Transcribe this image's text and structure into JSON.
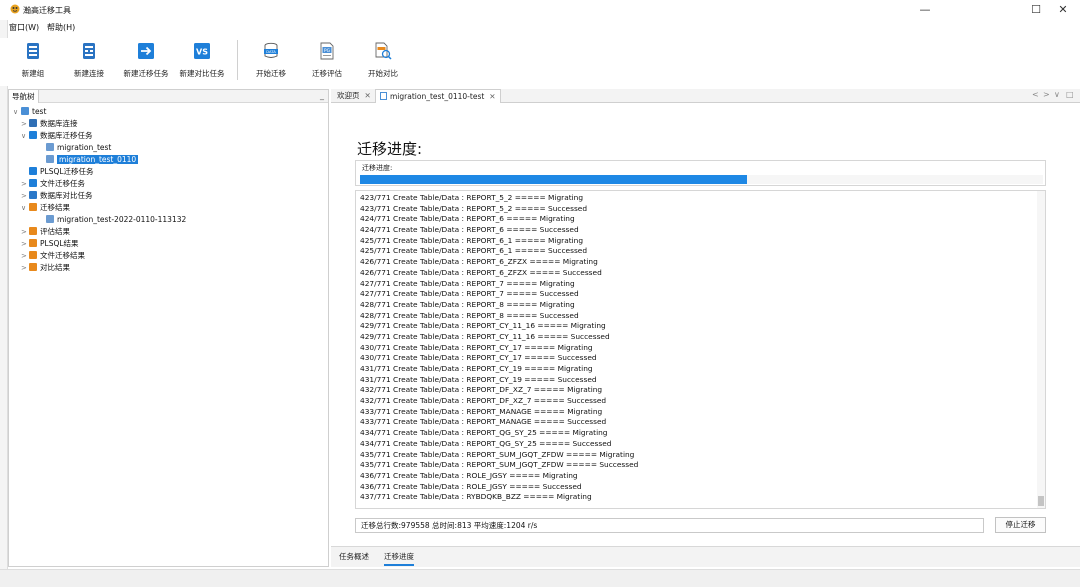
{
  "window": {
    "title": "瀚高迁移工具",
    "minimize": "—",
    "maximize": "☐",
    "close": "✕"
  },
  "menu": {
    "window": "窗口(W)",
    "help": "帮助(H)"
  },
  "toolbar": {
    "buttons": [
      {
        "label": "新建组",
        "icon": "database-group-icon"
      },
      {
        "label": "新建连接",
        "icon": "database-connection-icon"
      },
      {
        "label": "新建迁移任务",
        "icon": "migration-task-icon"
      },
      {
        "label": "新建对比任务",
        "icon": "compare-task-icon",
        "glyph": "VS"
      },
      {
        "label": "开始迁移",
        "icon": "start-migration-icon",
        "glyph": "DATA"
      },
      {
        "label": "迁移评估",
        "icon": "migration-assessment-icon",
        "glyph": "PG"
      },
      {
        "label": "开始对比",
        "icon": "start-compare-icon"
      }
    ]
  },
  "nav": {
    "tab_label": "导航树",
    "minimize": "_",
    "tree": [
      {
        "label": "test",
        "toggle": "∨",
        "level": 0,
        "color": "#4a8fd6"
      },
      {
        "label": "数据库连接",
        "toggle": ">",
        "level": 1,
        "color": "#2f6fb5"
      },
      {
        "label": "数据库迁移任务",
        "toggle": "∨",
        "level": 1,
        "color": "#1e7fd9"
      },
      {
        "label": "migration_test",
        "toggle": "",
        "level": 2,
        "color": "#6b9bd1"
      },
      {
        "label": "migration_test_0110",
        "toggle": "",
        "level": 2,
        "color": "#6b9bd1",
        "selected": true
      },
      {
        "label": "PLSQL迁移任务",
        "toggle": "",
        "level": 1,
        "color": "#1e7fd9"
      },
      {
        "label": "文件迁移任务",
        "toggle": ">",
        "level": 1,
        "color": "#1e7fd9"
      },
      {
        "label": "数据库对比任务",
        "toggle": ">",
        "level": 1,
        "color": "#2a78c9"
      },
      {
        "label": "迁移结果",
        "toggle": "∨",
        "level": 1,
        "color": "#e8891c"
      },
      {
        "label": "migration_test-2022-0110-113132",
        "toggle": "",
        "level": 2,
        "color": "#6b9bd1"
      },
      {
        "label": "评估结果",
        "toggle": ">",
        "level": 1,
        "color": "#e8891c"
      },
      {
        "label": "PLSQL结果",
        "toggle": ">",
        "level": 1,
        "color": "#e8891c"
      },
      {
        "label": "文件迁移结果",
        "toggle": ">",
        "level": 1,
        "color": "#e8891c"
      },
      {
        "label": "对比结果",
        "toggle": ">",
        "level": 1,
        "color": "#e8891c"
      }
    ]
  },
  "editor": {
    "tabs": [
      {
        "label": "欢迎页",
        "close": "✕"
      },
      {
        "label": "migration_test_0110-test",
        "close": "✕",
        "active": true
      }
    ],
    "controls": {
      "prev": "<",
      "next": ">",
      "menu": "∨",
      "minimize": "□"
    },
    "heading": "迁移进度:",
    "progress_label": "迁移进度:",
    "progress_fraction": 0.567,
    "log_lines": [
      "423/771 Create Table/Data : REPORT_5_2 ===== Migrating",
      "423/771 Create Table/Data : REPORT_5_2 ===== Successed",
      "424/771 Create Table/Data : REPORT_6 ===== Migrating",
      "424/771 Create Table/Data : REPORT_6 ===== Successed",
      "425/771 Create Table/Data : REPORT_6_1 ===== Migrating",
      "425/771 Create Table/Data : REPORT_6_1 ===== Successed",
      "426/771 Create Table/Data : REPORT_6_ZFZX ===== Migrating",
      "426/771 Create Table/Data : REPORT_6_ZFZX ===== Successed",
      "427/771 Create Table/Data : REPORT_7 ===== Migrating",
      "427/771 Create Table/Data : REPORT_7 ===== Successed",
      "428/771 Create Table/Data : REPORT_8 ===== Migrating",
      "428/771 Create Table/Data : REPORT_8 ===== Successed",
      "429/771 Create Table/Data : REPORT_CY_11_16 ===== Migrating",
      "429/771 Create Table/Data : REPORT_CY_11_16 ===== Successed",
      "430/771 Create Table/Data : REPORT_CY_17 ===== Migrating",
      "430/771 Create Table/Data : REPORT_CY_17 ===== Successed",
      "431/771 Create Table/Data : REPORT_CY_19 ===== Migrating",
      "431/771 Create Table/Data : REPORT_CY_19 ===== Successed",
      "432/771 Create Table/Data : REPORT_DF_XZ_7 ===== Migrating",
      "432/771 Create Table/Data : REPORT_DF_XZ_7 ===== Successed",
      "433/771 Create Table/Data : REPORT_MANAGE ===== Migrating",
      "433/771 Create Table/Data : REPORT_MANAGE ===== Successed",
      "434/771 Create Table/Data : REPORT_QG_SY_25 ===== Migrating",
      "434/771 Create Table/Data : REPORT_QG_SY_25 ===== Successed",
      "435/771 Create Table/Data : REPORT_SUM_JGQT_ZFDW ===== Migrating",
      "435/771 Create Table/Data : REPORT_SUM_JGQT_ZFDW ===== Successed",
      "436/771 Create Table/Data : ROLE_JGSY ===== Migrating",
      "436/771 Create Table/Data : ROLE_JGSY ===== Successed",
      "437/771 Create Table/Data : RYBDQKB_BZZ ===== Migrating"
    ],
    "summary": "迁移总行数:979558  总时间:813 平均速度:1204 r/s",
    "stop_button": "停止迁移",
    "bottom_tabs": [
      {
        "label": "任务概述"
      },
      {
        "label": "迁移进度",
        "active": true
      }
    ]
  }
}
